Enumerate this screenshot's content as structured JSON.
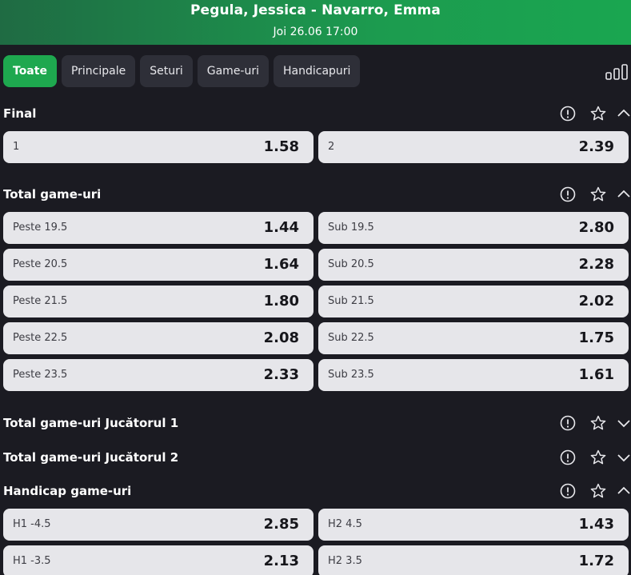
{
  "header": {
    "title": "Pegula, Jessica - Navarro, Emma",
    "date": "Joi 26.06 17:00"
  },
  "tabs": [
    {
      "label": "Toate",
      "active": true
    },
    {
      "label": "Principale"
    },
    {
      "label": "Seturi"
    },
    {
      "label": "Game-uri"
    },
    {
      "label": "Handicapuri"
    }
  ],
  "icons": {
    "stats": "bar-chart-icon",
    "info": "info-icon",
    "star": "star-icon",
    "chevron_up": "chevron-up-icon",
    "chevron_down": "chevron-down-icon"
  },
  "colors": {
    "accent": "#1ea84f",
    "background": "#1b1b22",
    "tab_bg": "#2e2f38",
    "odd_bg": "#e6e6ea"
  },
  "sections": {
    "final": {
      "title": "Final",
      "expanded": true,
      "odds": [
        {
          "label": "1",
          "value": "1.58"
        },
        {
          "label": "2",
          "value": "2.39"
        }
      ]
    },
    "total_games": {
      "title": "Total game-uri",
      "expanded": true,
      "rows": [
        {
          "over": {
            "label": "Peste 19.5",
            "value": "1.44"
          },
          "under": {
            "label": "Sub 19.5",
            "value": "2.80"
          }
        },
        {
          "over": {
            "label": "Peste 20.5",
            "value": "1.64"
          },
          "under": {
            "label": "Sub 20.5",
            "value": "2.28"
          }
        },
        {
          "over": {
            "label": "Peste 21.5",
            "value": "1.80"
          },
          "under": {
            "label": "Sub 21.5",
            "value": "2.02"
          }
        },
        {
          "over": {
            "label": "Peste 22.5",
            "value": "2.08"
          },
          "under": {
            "label": "Sub 22.5",
            "value": "1.75"
          }
        },
        {
          "over": {
            "label": "Peste 23.5",
            "value": "2.33"
          },
          "under": {
            "label": "Sub 23.5",
            "value": "1.61"
          }
        }
      ]
    },
    "player1_games": {
      "title": "Total game-uri Jucătorul 1",
      "expanded": false
    },
    "player2_games": {
      "title": "Total game-uri Jucătorul 2",
      "expanded": false
    },
    "handicap_games": {
      "title": "Handicap game-uri",
      "expanded": true,
      "rows": [
        {
          "h1": {
            "label": "H1 -4.5",
            "value": "2.85"
          },
          "h2": {
            "label": "H2 4.5",
            "value": "1.43"
          }
        },
        {
          "h1": {
            "label": "H1 -3.5",
            "value": "2.13"
          },
          "h2": {
            "label": "H2 3.5",
            "value": "1.72"
          }
        }
      ]
    }
  }
}
